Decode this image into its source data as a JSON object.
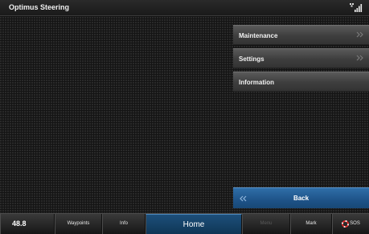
{
  "titlebar": {
    "title": "Optimus Steering",
    "status_icon": "gps-signal-icon"
  },
  "menu": {
    "items": [
      {
        "label": "Maintenance",
        "has_submenu": true
      },
      {
        "label": "Settings",
        "has_submenu": true
      },
      {
        "label": "Information",
        "has_submenu": false
      }
    ],
    "back_label": "Back"
  },
  "bottombar": {
    "speed": "48.8",
    "waypoints": "Waypoints",
    "info": "Info",
    "home": "Home",
    "menu": "Menu",
    "mark": "Mark",
    "sos": "SOS"
  },
  "colors": {
    "accent_blue": "#1e5388",
    "sos_red": "#e02a2a",
    "button_gray": "#3e3e3e"
  }
}
